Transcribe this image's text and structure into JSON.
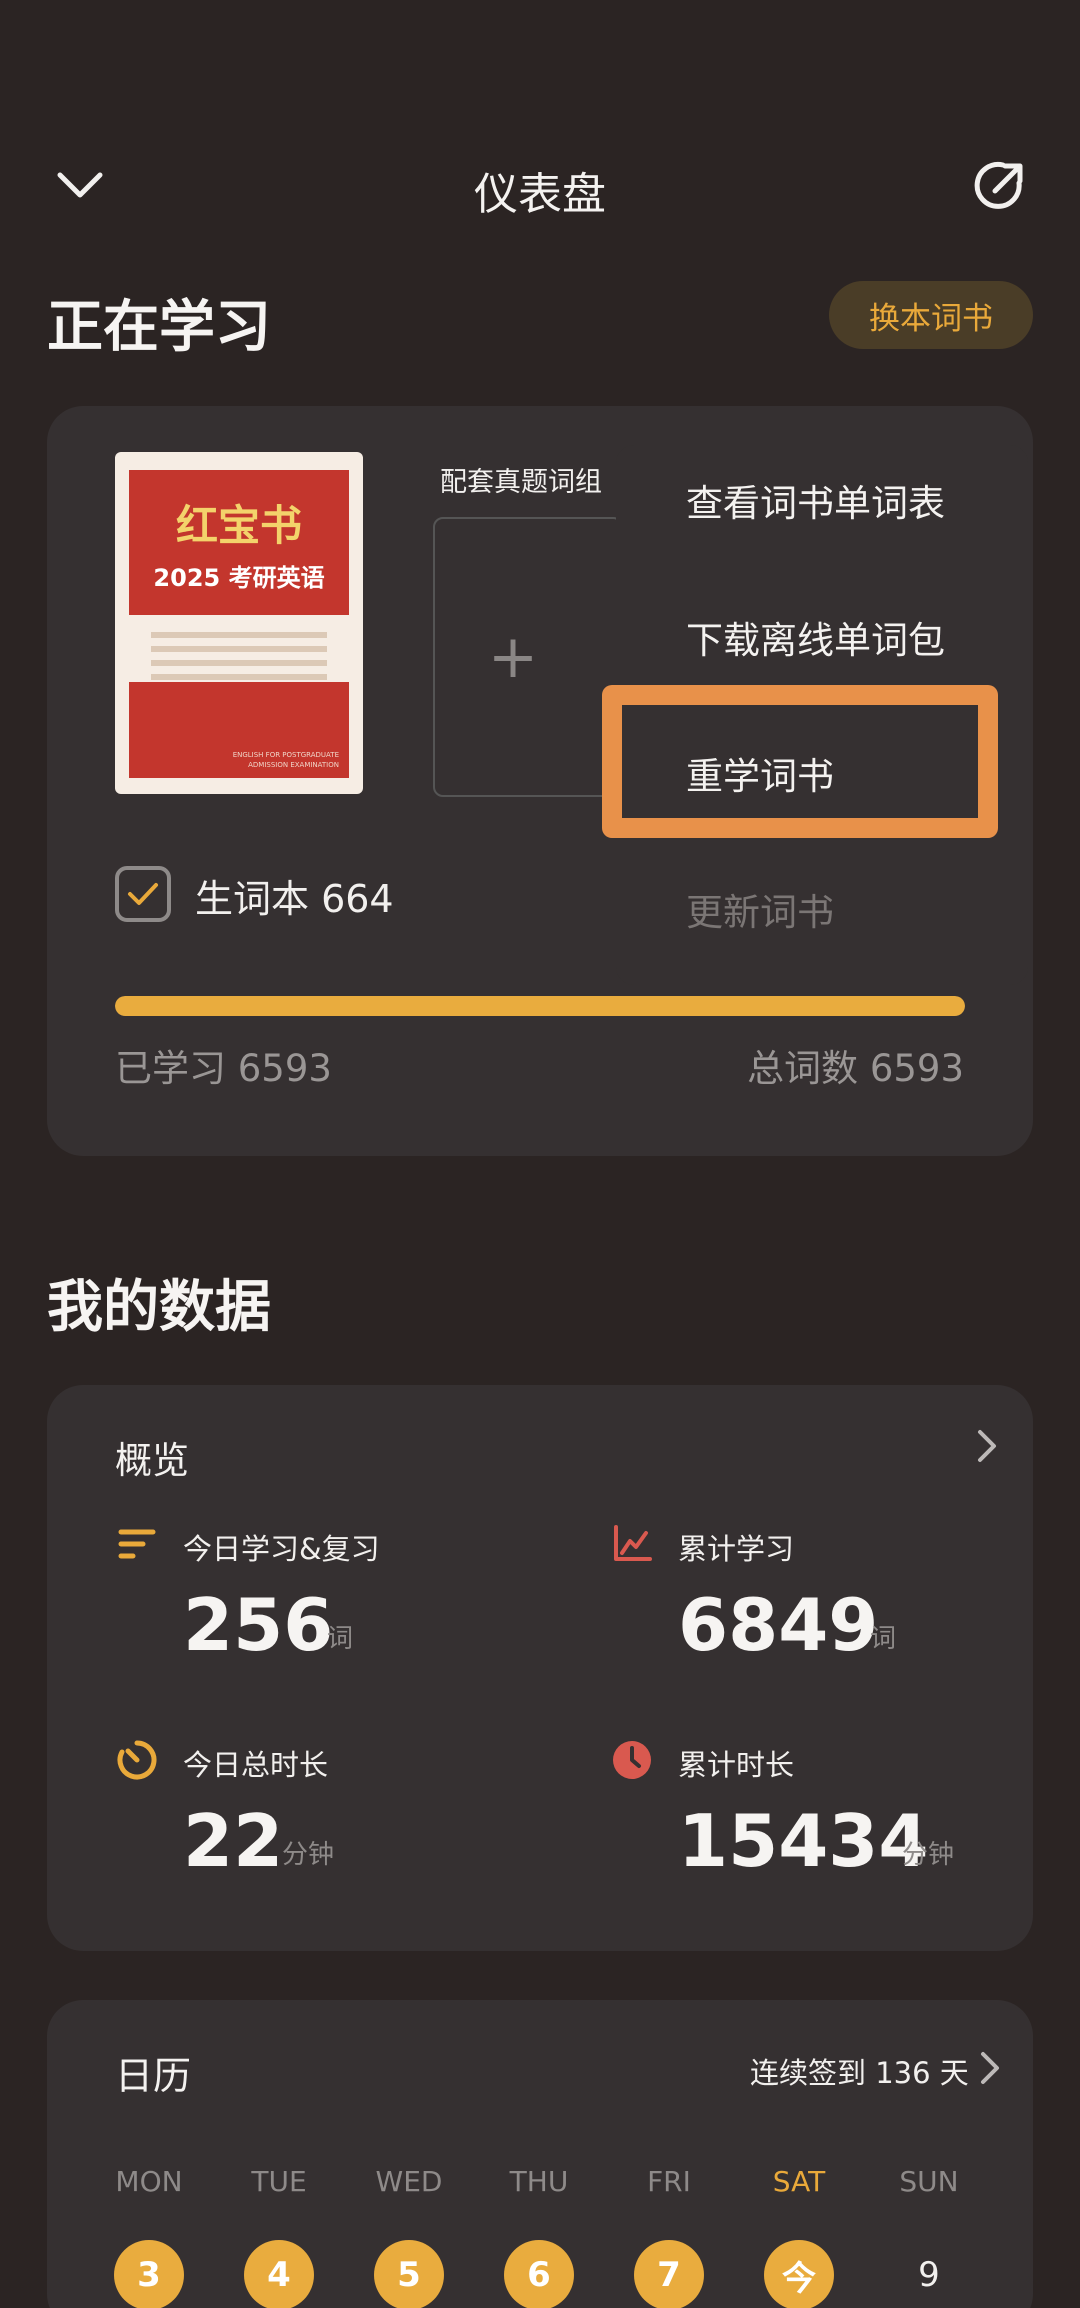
{
  "header": {
    "title": "仪表盘",
    "back_icon": "chevron-down-icon",
    "share_icon": "external-link-icon"
  },
  "studying": {
    "section_title": "正在学习",
    "change_book_label": "换本词书",
    "book": {
      "cover_title": "红宝书",
      "cover_subtitle": "2025 考研英语",
      "cover_small_text": "ENGLISH FOR POSTGRADUATE ADMISSION EXAMINATION"
    },
    "extra_label": "配套真题词组",
    "add_label": "+",
    "vocab_checkbox_checked": true,
    "vocab_label": "生词本 664",
    "learned_label": "已学习 6593",
    "total_label": "总词数 6593",
    "progress_fraction": 1.0,
    "menu": {
      "items": [
        {
          "label": "查看词书单词表",
          "disabled": false
        },
        {
          "label": "下载离线单词包",
          "disabled": false
        },
        {
          "label": "重学词书",
          "disabled": false,
          "highlighted": true
        },
        {
          "label": "更新词书",
          "disabled": true
        }
      ]
    }
  },
  "mydata": {
    "section_title": "我的数据",
    "overview": {
      "title": "概览",
      "stats": [
        {
          "label": "今日学习&复习",
          "value": "256",
          "unit": "词",
          "icon": "list-icon",
          "color": "#e9a93a"
        },
        {
          "label": "累计学习",
          "value": "6849",
          "unit": "词",
          "icon": "trend-chart-icon",
          "color": "#d9594f"
        },
        {
          "label": "今日总时长",
          "value": "22",
          "unit": "分钟",
          "icon": "timer-icon",
          "color": "#e9a93a"
        },
        {
          "label": "累计时长",
          "value": "15434",
          "unit": "分钟",
          "icon": "clock-icon",
          "color": "#d9594f"
        }
      ]
    }
  },
  "calendar": {
    "title": "日历",
    "streak_label": "连续签到 136 天",
    "weekdays": [
      "MON",
      "TUE",
      "WED",
      "THU",
      "FRI",
      "SAT",
      "SUN"
    ],
    "days": [
      {
        "label": "3",
        "checked": true
      },
      {
        "label": "4",
        "checked": true
      },
      {
        "label": "5",
        "checked": true
      },
      {
        "label": "6",
        "checked": true
      },
      {
        "label": "7",
        "checked": true
      },
      {
        "label": "今",
        "checked": true
      },
      {
        "label": "9",
        "checked": false
      }
    ]
  },
  "colors": {
    "background": "#2b2423",
    "card": "#353031",
    "accent": "#e9ac3e",
    "highlight_border": "#e8914a",
    "red_accent": "#d9594f"
  }
}
